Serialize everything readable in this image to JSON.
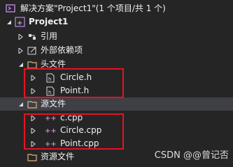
{
  "solution": {
    "label": "解决方案\"Project1\"(1 个项目/共 1 个)"
  },
  "project": {
    "label": "Project1"
  },
  "nodes": {
    "references": "引用",
    "external_deps": "外部依赖项",
    "headers": "头文件",
    "header_files": [
      "Circle.h",
      "Point.h"
    ],
    "sources": "源文件",
    "source_files": [
      "c.cpp",
      "Circle.cpp",
      "Point.cpp"
    ],
    "resources": "资源文件"
  },
  "watermark": "CSDN @@曾记否",
  "colors": {
    "highlight": "#e81123",
    "background": "#252526",
    "folder": "#dcb67a",
    "cpp": "#c586c0"
  }
}
